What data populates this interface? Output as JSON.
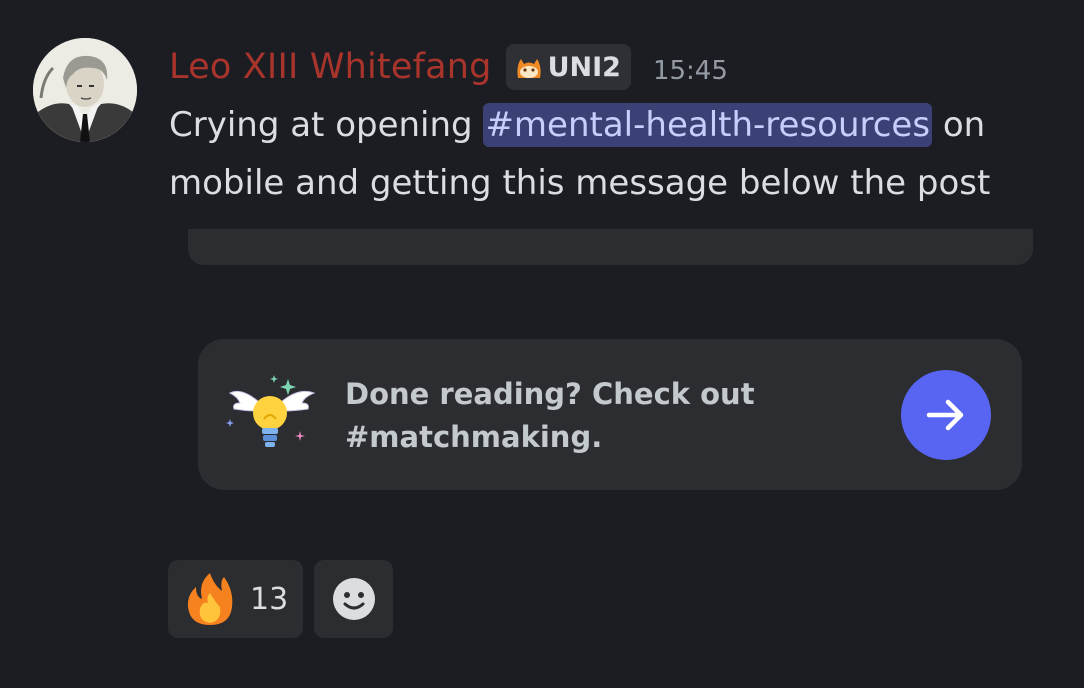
{
  "message": {
    "author": "Leo XIII Whitefang",
    "tag": "UNI2",
    "timestamp": "15:45",
    "text_before": "Crying at opening ",
    "channel_mention": "#mental-health-resources",
    "text_after": " on mobile and getting this message below the post"
  },
  "prompt_card": {
    "line1": "Done reading? Check out",
    "line2": "#matchmaking."
  },
  "reactions": [
    {
      "emoji": "fire-icon",
      "count": "13"
    },
    {
      "emoji": "add-reaction-icon"
    }
  ],
  "colors": {
    "background": "#1c1d22",
    "username": "#a8342c",
    "mention_bg": "#3c4175",
    "accent": "#5865f2",
    "card_bg": "#2b2d31"
  }
}
